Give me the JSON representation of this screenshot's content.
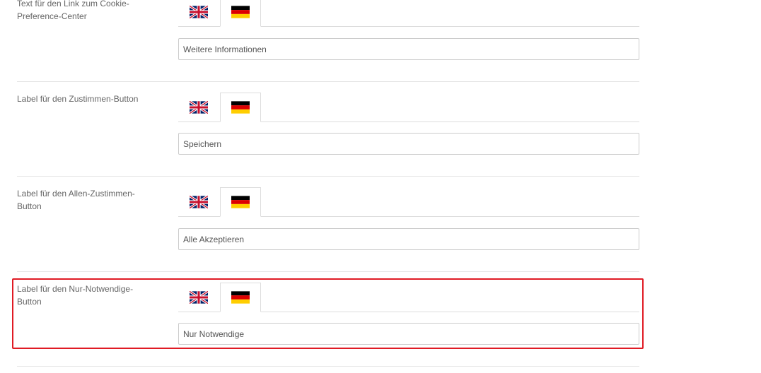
{
  "fields": [
    {
      "label": "Text für den Link zum Cookie-Preference-Center",
      "value": "Weitere Informationen"
    },
    {
      "label": "Label für den Zustimmen-Button",
      "value": "Speichern"
    },
    {
      "label": "Label für den Allen-Zustimmen-Button",
      "value": "Alle Akzeptieren"
    },
    {
      "label": "Label für den Nur-Notwendige-Button",
      "value": "Nur Notwendige"
    }
  ],
  "tabs": {
    "en_icon": "uk-flag-icon",
    "de_icon": "german-flag-icon",
    "active": "de"
  },
  "colors": {
    "highlight": "#e01b24",
    "border": "#dddddd"
  }
}
